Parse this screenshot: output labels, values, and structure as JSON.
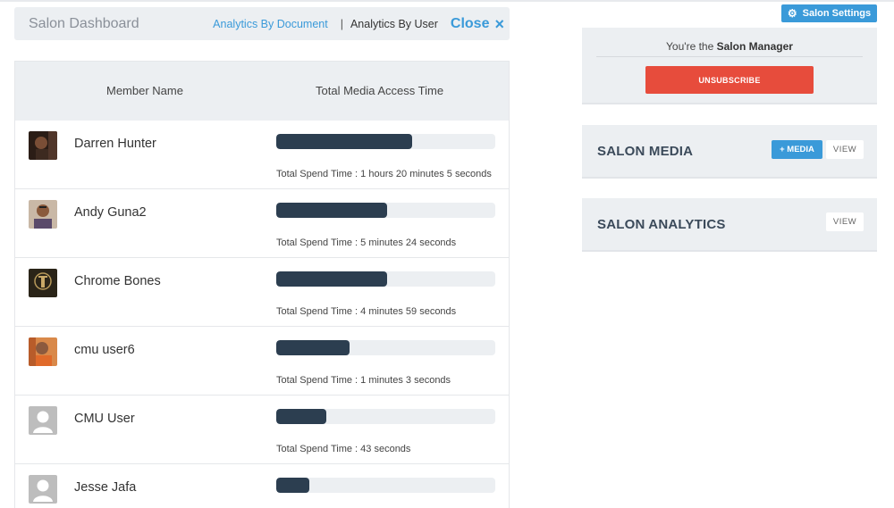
{
  "header": {
    "title": "Salon Dashboard",
    "link_document": "Analytics By Document",
    "separator": "|",
    "link_user": "Analytics By User",
    "close_label": "Close",
    "close_icon": "×"
  },
  "table": {
    "col_name": "Member Name",
    "col_time": "Total Media Access Time",
    "rows": [
      {
        "name": "Darren Hunter",
        "spend": "Total Spend Time : 1 hours 20 minutes 5 seconds",
        "fill": 0.62,
        "avatar": "photo-dark"
      },
      {
        "name": "Andy Guna2",
        "spend": "Total Spend Time : 5 minutes 24 seconds",
        "fill": 0.505,
        "avatar": "photo-person"
      },
      {
        "name": "Chrome Bones",
        "spend": "Total Spend Time : 4 minutes 59 seconds",
        "fill": 0.505,
        "avatar": "photo-logo"
      },
      {
        "name": "cmu user6",
        "spend": "Total Spend Time : 1 minutes 3 seconds",
        "fill": 0.335,
        "avatar": "photo-orange"
      },
      {
        "name": "CMU User",
        "spend": "Total Spend Time : 43 seconds",
        "fill": 0.23,
        "avatar": "placeholder"
      },
      {
        "name": "Jesse Jafa",
        "spend": "",
        "fill": 0.15,
        "avatar": "placeholder"
      }
    ]
  },
  "sidebar": {
    "settings_label": "Salon Settings",
    "settings_icon": "gear-icon",
    "manager_prefix": "You're the",
    "manager_role": "Salon Manager",
    "unsubscribe_label": "UNSUBSCRIBE",
    "media_title": "SALON MEDIA",
    "add_media_label": "+ MEDIA",
    "media_view_label": "VIEW",
    "analytics_title": "SALON ANALYTICS",
    "analytics_view_label": "VIEW"
  },
  "colors": {
    "accent": "#3a9ad9",
    "danger": "#e74c3c",
    "bar": "#2c3e50",
    "panel": "#eceff2"
  }
}
